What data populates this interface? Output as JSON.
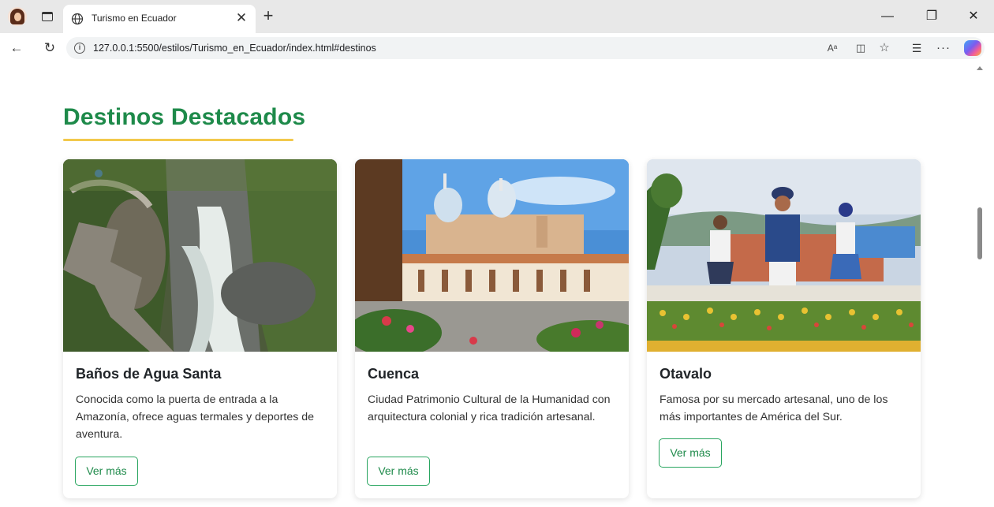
{
  "browser": {
    "tab_title": "Turismo en Ecuador",
    "url": "127.0.0.1:5500/estilos/Turismo_en_Ecuador/index.html#destinos",
    "read_aloud_label": "Aᵃ"
  },
  "section": {
    "title": "Destinos Destacados"
  },
  "cards": [
    {
      "image_icon": "waterfall-canyon-photo",
      "title": "Baños de Agua Santa",
      "text": "Conocida como la puerta de entrada a la Amazonía, ofrece aguas termales y deportes de aventura.",
      "button": "Ver más"
    },
    {
      "image_icon": "cathedral-plaza-photo",
      "title": "Cuenca",
      "text": "Ciudad Patrimonio Cultural de la Humanidad con arquitectura colonial y rica tradición artesanal.",
      "button": "Ver más"
    },
    {
      "image_icon": "statues-monument-photo",
      "title": "Otavalo",
      "text": "Famosa por su mercado artesanal, uno de los más importantes de América del Sur.",
      "button": "Ver más"
    }
  ],
  "colors": {
    "title_green": "#1e8a4a",
    "underline_gold": "#f2c94c",
    "button_border": "#28a55f"
  }
}
